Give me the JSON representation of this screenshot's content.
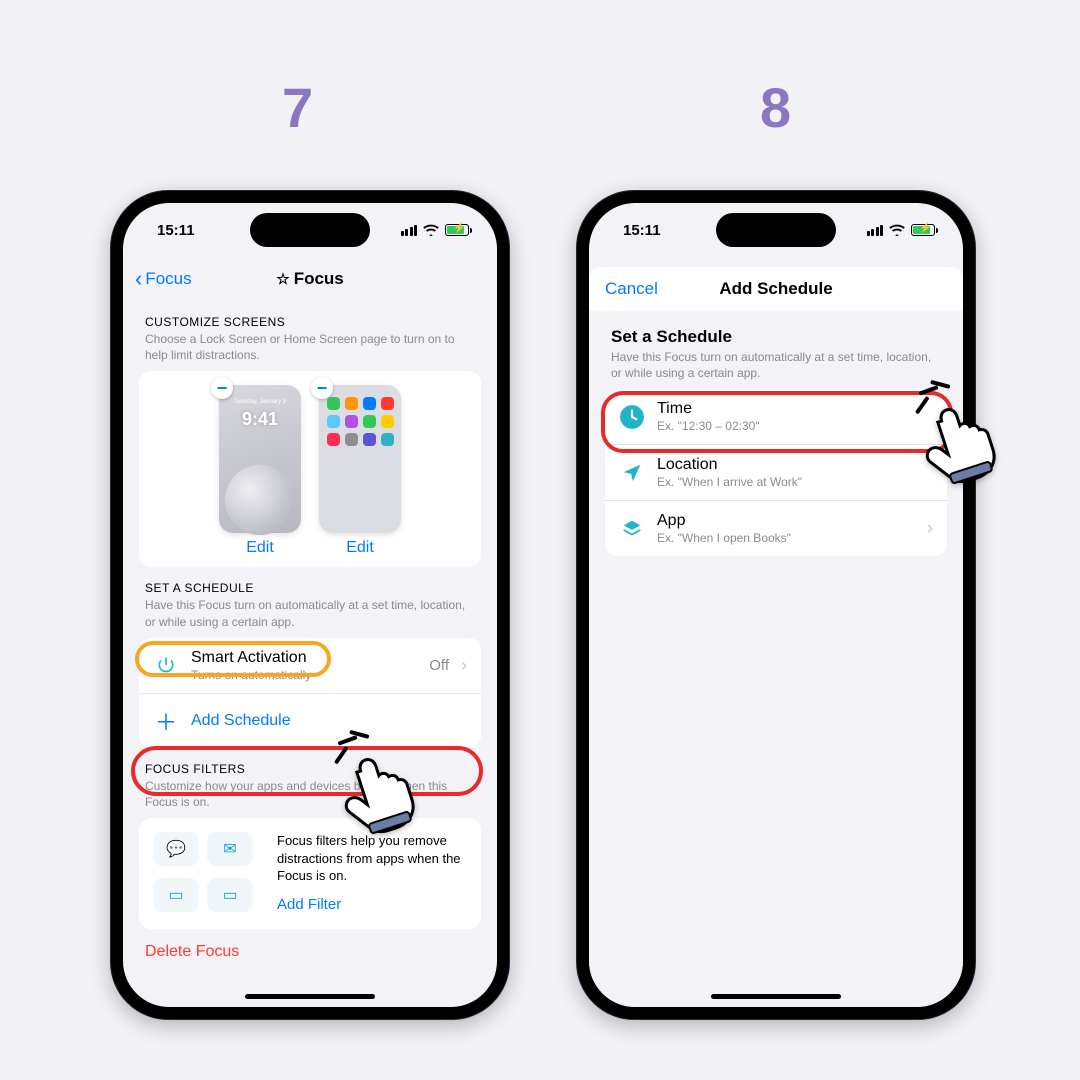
{
  "labels": {
    "step7": "7",
    "step8": "8"
  },
  "status": {
    "time": "15:11"
  },
  "left": {
    "back": "Focus",
    "title": "Focus",
    "customize": {
      "header": "CUSTOMIZE SCREENS",
      "sub": "Choose a Lock Screen or Home Screen page to turn on to help limit distractions.",
      "lockClock": "9:41",
      "lockDate": "Tuesday, January 9",
      "edit": "Edit"
    },
    "schedule": {
      "header": "SET A SCHEDULE",
      "sub": "Have this Focus turn on automatically at a set time, location, or while using a certain app.",
      "smart": {
        "title": "Smart Activation",
        "sub": "Turns on automatically",
        "value": "Off"
      },
      "add": "Add Schedule"
    },
    "filters": {
      "header": "FOCUS FILTERS",
      "sub": "Customize how your apps and devices behave when this Focus is on.",
      "desc": "Focus filters help you remove distractions from apps when the Focus is on.",
      "add": "Add Filter"
    },
    "delete": "Delete Focus"
  },
  "right": {
    "cancel": "Cancel",
    "title": "Add Schedule",
    "sect": {
      "title": "Set a Schedule",
      "sub": "Have this Focus turn on automatically at a set time, location, or while using a certain app."
    },
    "rows": {
      "time": {
        "title": "Time",
        "sub": "Ex. \"12:30 – 02:30\""
      },
      "loc": {
        "title": "Location",
        "sub": "Ex. \"When I arrive at Work\""
      },
      "app": {
        "title": "App",
        "sub": "Ex. \"When I open Books\""
      }
    }
  },
  "colors": {
    "teal": "#20b5c9",
    "link": "#007aff"
  }
}
